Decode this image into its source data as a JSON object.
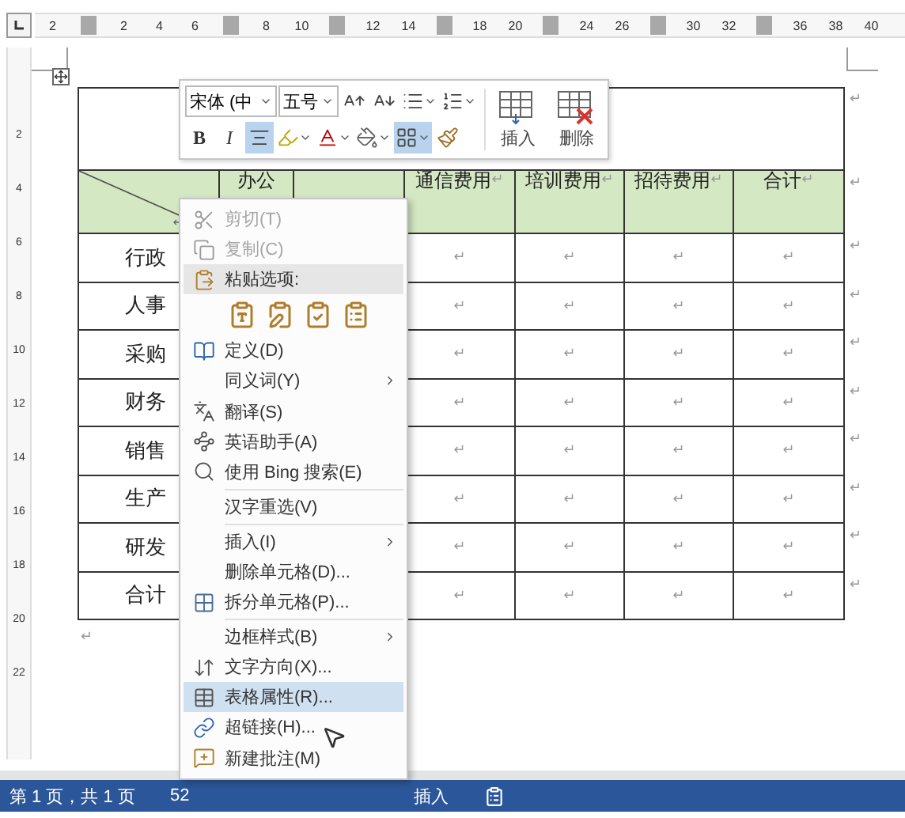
{
  "ruler": {
    "slots": [
      {
        "kind": "number",
        "label": "2"
      },
      {
        "kind": "marker"
      },
      {
        "kind": "number",
        "label": "2"
      },
      {
        "kind": "number",
        "label": "4"
      },
      {
        "kind": "number",
        "label": "6"
      },
      {
        "kind": "marker"
      },
      {
        "kind": "number",
        "label": "8"
      },
      {
        "kind": "number",
        "label": "10"
      },
      {
        "kind": "marker"
      },
      {
        "kind": "number",
        "label": "12"
      },
      {
        "kind": "number",
        "label": "14"
      },
      {
        "kind": "marker"
      },
      {
        "kind": "number",
        "label": "18"
      },
      {
        "kind": "number",
        "label": "20"
      },
      {
        "kind": "marker"
      },
      {
        "kind": "number",
        "label": "24"
      },
      {
        "kind": "number",
        "label": "26"
      },
      {
        "kind": "marker"
      },
      {
        "kind": "number",
        "label": "30"
      },
      {
        "kind": "number",
        "label": "32"
      },
      {
        "kind": "marker"
      },
      {
        "kind": "number",
        "label": "36"
      },
      {
        "kind": "number",
        "label": "38"
      },
      {
        "kind": "number",
        "label": "40"
      }
    ]
  },
  "vertical_ruler": {
    "labels": [
      "2",
      "4",
      "6",
      "8",
      "10",
      "12",
      "14",
      "16",
      "18",
      "20",
      "22"
    ]
  },
  "table": {
    "title_end_mark": "↵",
    "header": {
      "cells": [
        {
          "kind": "diagonal",
          "mark": "↵"
        },
        {
          "kind": "text",
          "text": "办公"
        },
        {
          "kind": "blank"
        },
        {
          "kind": "text",
          "text": "通信费用",
          "mark": "↵"
        },
        {
          "kind": "text",
          "text": "培训费用",
          "mark": "↵"
        },
        {
          "kind": "text",
          "text": "招待费用",
          "mark": "↵"
        },
        {
          "kind": "text",
          "text": "合计",
          "mark": "↵"
        }
      ],
      "end_mark": "↵"
    },
    "rows": [
      {
        "label": "行政",
        "marks": [
          "↵",
          "↵",
          "↵",
          "↵"
        ],
        "end_mark": "↵"
      },
      {
        "label": "人事",
        "marks": [
          "↵",
          "↵",
          "↵",
          "↵"
        ],
        "end_mark": "↵"
      },
      {
        "label": "采购",
        "marks": [
          "↵",
          "↵",
          "↵",
          "↵"
        ],
        "end_mark": "↵"
      },
      {
        "label": "财务",
        "marks": [
          "↵",
          "↵",
          "↵",
          "↵"
        ],
        "end_mark": "↵"
      },
      {
        "label": "销售",
        "marks": [
          "↵",
          "↵",
          "↵",
          "↵"
        ],
        "end_mark": "↵"
      },
      {
        "label": "生产",
        "marks": [
          "↵",
          "↵",
          "↵",
          "↵"
        ],
        "end_mark": "↵"
      },
      {
        "label": "研发",
        "marks": [
          "↵",
          "↵",
          "↵",
          "↵"
        ],
        "end_mark": "↵"
      },
      {
        "label": "合计",
        "marks": [
          "↵",
          "↵",
          "↵",
          "↵"
        ],
        "end_mark": "↵"
      }
    ],
    "after_mark": "↵"
  },
  "mini_toolbar": {
    "font": "宋体 (中",
    "size": "五号",
    "row1": [
      {
        "kind": "grow",
        "dropdown": false
      },
      {
        "kind": "shrink",
        "dropdown": false
      },
      {
        "kind": "bullets",
        "dropdown": true
      },
      {
        "kind": "numbering",
        "dropdown": true
      }
    ],
    "row2": [
      {
        "kind": "bold",
        "label": "B",
        "selected": false,
        "dropdown": false
      },
      {
        "kind": "italic",
        "label": "I",
        "selected": false,
        "dropdown": false
      },
      {
        "kind": "center",
        "selected": true,
        "dropdown": false
      },
      {
        "kind": "highlight",
        "selected": false,
        "dropdown": true
      },
      {
        "kind": "font-color",
        "selected": false,
        "dropdown": true
      },
      {
        "kind": "shading",
        "selected": false,
        "dropdown": true
      },
      {
        "kind": "borders",
        "selected": true,
        "dropdown": true
      },
      {
        "kind": "painter",
        "selected": false,
        "dropdown": false
      }
    ],
    "big_buttons": [
      {
        "kind": "insert",
        "label": "插入"
      },
      {
        "kind": "delete",
        "label": "删除"
      }
    ]
  },
  "context_menu": {
    "items": [
      {
        "kind": "cut",
        "label": "剪切(T)",
        "disabled": true,
        "submenu": false,
        "selected": false
      },
      {
        "kind": "copy",
        "label": "复制(C)",
        "disabled": true,
        "submenu": false,
        "selected": false
      },
      {
        "kind": "paste-header",
        "label": "粘贴选项:"
      },
      {
        "kind": "paste-options"
      },
      {
        "kind": "define",
        "label": "定义(D)",
        "disabled": false,
        "submenu": false,
        "selected": false
      },
      {
        "kind": "plain",
        "label": "同义词(Y)",
        "disabled": false,
        "submenu": true,
        "selected": false
      },
      {
        "kind": "translate",
        "label": "翻译(S)",
        "disabled": false,
        "submenu": false,
        "selected": false
      },
      {
        "kind": "assistant",
        "label": "英语助手(A)",
        "disabled": false,
        "submenu": false,
        "selected": false
      },
      {
        "kind": "search",
        "label": "使用 Bing 搜索(E)",
        "disabled": false,
        "submenu": false,
        "selected": false
      },
      {
        "kind": "separator"
      },
      {
        "kind": "plain",
        "label": "汉字重选(V)",
        "disabled": false,
        "submenu": false,
        "selected": false
      },
      {
        "kind": "separator"
      },
      {
        "kind": "plain",
        "label": "插入(I)",
        "disabled": false,
        "submenu": true,
        "selected": false
      },
      {
        "kind": "plain",
        "label": "删除单元格(D)...",
        "disabled": false,
        "submenu": false,
        "selected": false
      },
      {
        "kind": "split",
        "label": "拆分单元格(P)...",
        "disabled": false,
        "submenu": false,
        "selected": false
      },
      {
        "kind": "separator"
      },
      {
        "kind": "plain",
        "label": "边框样式(B)",
        "disabled": false,
        "submenu": true,
        "selected": false
      },
      {
        "kind": "direction",
        "label": "文字方向(X)...",
        "disabled": false,
        "submenu": false,
        "selected": false
      },
      {
        "kind": "properties",
        "label": "表格属性(R)...",
        "disabled": false,
        "submenu": false,
        "selected": true
      },
      {
        "kind": "link",
        "label": "超链接(H)...",
        "disabled": false,
        "submenu": false,
        "selected": false
      },
      {
        "kind": "comment",
        "label": "新建批注(M)",
        "disabled": false,
        "submenu": false,
        "selected": false
      }
    ]
  },
  "status_bar": {
    "page": "第 1 页，共 1 页",
    "words": "52",
    "mode": "插入"
  }
}
